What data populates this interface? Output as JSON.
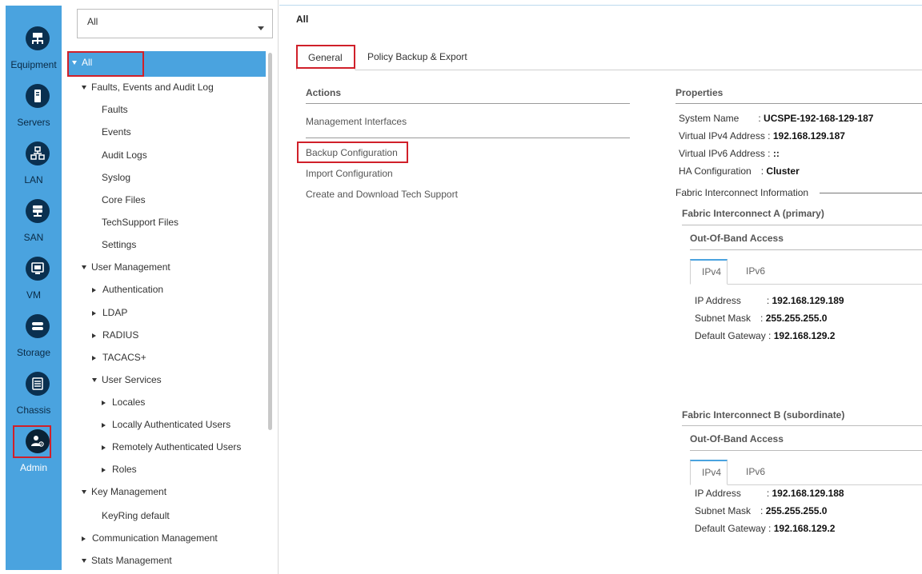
{
  "nav": {
    "items": [
      {
        "label": "Equipment",
        "icon": "equipment-icon"
      },
      {
        "label": "Servers",
        "icon": "server-icon"
      },
      {
        "label": "LAN",
        "icon": "lan-icon"
      },
      {
        "label": "SAN",
        "icon": "san-icon"
      },
      {
        "label": "VM",
        "icon": "vm-icon"
      },
      {
        "label": "Storage",
        "icon": "storage-icon"
      },
      {
        "label": "Chassis",
        "icon": "chassis-icon"
      },
      {
        "label": "Admin",
        "icon": "admin-icon"
      }
    ],
    "active": "Admin"
  },
  "tree": {
    "filter_value": "All",
    "root_label": "All",
    "rows": [
      "Faults, Events and Audit Log",
      "Faults",
      "Events",
      "Audit Logs",
      "Syslog",
      "Core Files",
      "TechSupport Files",
      "Settings",
      "User Management",
      "Authentication",
      "LDAP",
      "RADIUS",
      "TACACS+",
      "User Services",
      "Locales",
      "Locally Authenticated Users",
      "Remotely Authenticated Users",
      "Roles",
      "Key Management",
      "KeyRing default",
      "Communication Management",
      "Stats Management"
    ]
  },
  "main": {
    "breadcrumb": "All",
    "tabs": [
      "General",
      "Policy Backup & Export"
    ],
    "actions": {
      "title": "Actions",
      "links": [
        "Management Interfaces",
        "Backup Configuration",
        "Import Configuration",
        "Create and Download Tech Support"
      ]
    },
    "properties": {
      "title": "Properties",
      "system_name_label": "System Name",
      "system_name_value": "UCSPE-192-168-129-187",
      "ipv4_label": "Virtual IPv4 Address :",
      "ipv4_value": "192.168.129.187",
      "ipv6_label": "Virtual IPv6 Address :",
      "ipv6_value": "::",
      "ha_label": "HA Configuration",
      "ha_value": "Cluster",
      "fi_info_label": "Fabric Interconnect Information"
    },
    "fi_a": {
      "title": "Fabric Interconnect A (primary)",
      "oob_title": "Out-Of-Band Access",
      "tabs": [
        "IPv4",
        "IPv6"
      ],
      "ip_label": "IP Address",
      "ip_value": "192.168.129.189",
      "mask_label": "Subnet Mask",
      "mask_value": "255.255.255.0",
      "gw_label": "Default Gateway :",
      "gw_value": "192.168.129.2"
    },
    "fi_b": {
      "title": "Fabric Interconnect B (subordinate)",
      "oob_title": "Out-Of-Band Access",
      "tabs": [
        "IPv4",
        "IPv6"
      ],
      "ip_label": "IP Address",
      "ip_value": "192.168.129.188",
      "mask_label": "Subnet Mask",
      "mask_value": "255.255.255.0",
      "gw_label": "Default Gateway :",
      "gw_value": "192.168.129.2"
    }
  },
  "colors": {
    "rail": "#4aa3df",
    "icon_bg": "#0a3050",
    "highlight_box": "#d0202a"
  }
}
